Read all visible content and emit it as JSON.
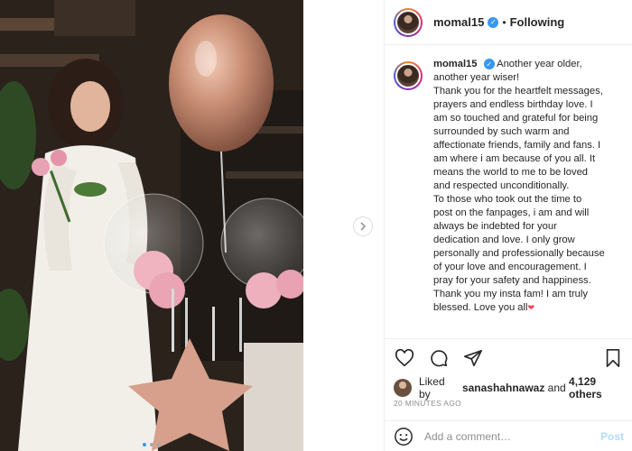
{
  "post": {
    "username": "momal15",
    "follow_status": "Following",
    "separator": "•",
    "caption": {
      "username": "momal15",
      "lines": [
        "Another year older,",
        "another year wiser!",
        "Thank you for the heartfelt messages,",
        "prayers and endless birthday love. I",
        "am so touched and grateful for being",
        "surrounded by such warm and",
        "affectionate friends, family and fans. I",
        "am where i am because of you all. It",
        "means the world to me to be loved",
        "and respected unconditionally.",
        "To those who took out the time to",
        "post on the fanpages, i am and will",
        "always be indebted for your",
        "dedication and love. I only grow",
        "personally and professionally because",
        "of your love and encouragement. I",
        "pray for your safety and happiness.",
        "Thank you my insta fam! I am truly",
        "blessed. Love you all"
      ],
      "end_emoji": "❤"
    },
    "likes": {
      "prefix": "Liked by",
      "user": "sanashahnawaz",
      "conj": "and",
      "count": "4,129 others"
    },
    "timestamp": "20 MINUTES AGO"
  },
  "comment": {
    "placeholder": "Add a comment…",
    "post_label": "Post"
  },
  "icons": {
    "next": "chevron-right-icon",
    "like": "heart-icon",
    "comment": "comment-icon",
    "share": "share-icon",
    "save": "bookmark-icon",
    "emoji": "emoji-icon",
    "verified": "verified-badge-icon"
  },
  "colors": {
    "link_blue": "#3897f0",
    "post_disabled": "#b3dbff",
    "heart_red": "#ed4956"
  }
}
